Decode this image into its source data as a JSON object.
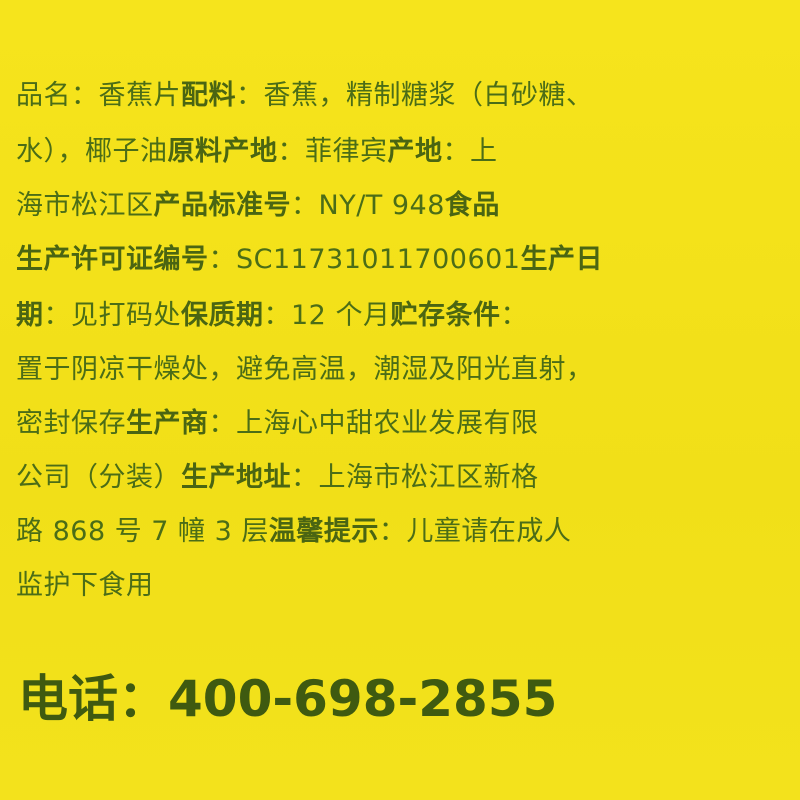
{
  "lines": [
    {
      "a": "品名：香蕉片",
      "b": "配料",
      "c": "：香蕉，精制糖浆（白砂糖、"
    },
    {
      "a": "水），椰子油",
      "b": "原料产地",
      "c": "：菲律宾",
      "d": "产地",
      "e": "：上"
    },
    {
      "a": "海市松江区",
      "b": "产品标准号",
      "c": "：NY/T 948",
      "d": "食品"
    },
    {
      "a": "生产许可证编号",
      "b": "：SC11731011700601",
      "c": "生产日"
    },
    {
      "a": "期",
      "b": "：见打码处",
      "c": "保质期",
      "d": "：12 个月",
      "e": "贮存条件",
      "f": "："
    },
    {
      "a": "置于阴凉干燥处，避免高温，潮湿及阳光直射，"
    },
    {
      "a": "密封保存",
      "b": "生产商",
      "c": "：上海心中甜农业发展有限"
    },
    {
      "a": "公司（分装）",
      "b": "生产地址",
      "c": "：上海市松江区新格"
    },
    {
      "a": "路 868 号 7 幢 3 层",
      "b": "温馨提示",
      "c": "：儿童请在成人"
    },
    {
      "a": "监护下食用"
    }
  ],
  "phone": "电话：400-698-2855"
}
